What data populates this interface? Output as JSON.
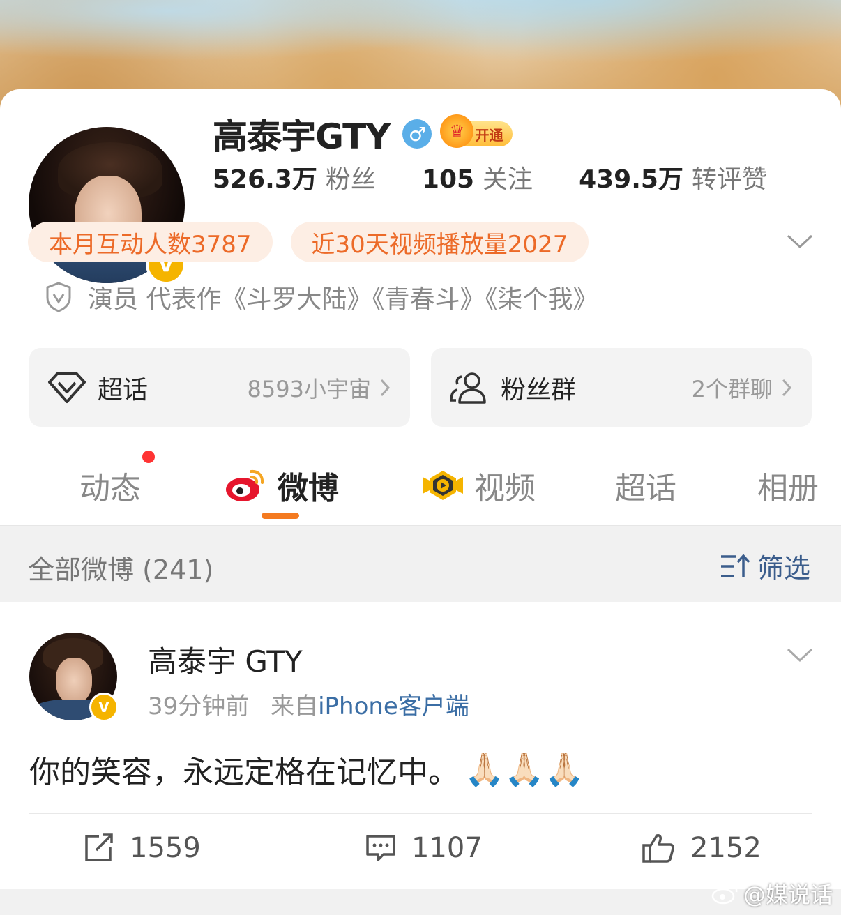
{
  "profile": {
    "name": "高泰宇GTY",
    "gender_icon": "male-icon",
    "gender_symbol": "♂",
    "vip_label": "开通",
    "verify_badge": "V",
    "stats": [
      {
        "num": "526.3万",
        "label": "粉丝"
      },
      {
        "num": "105",
        "label": "关注"
      },
      {
        "num": "439.5万",
        "label": "转评赞"
      }
    ],
    "pills": [
      "本月互动人数3787",
      "近30天视频播放量2027"
    ],
    "verification": "演员 代表作《斗罗大陆》《青春斗》《柒个我》"
  },
  "boxes": [
    {
      "title": "超话",
      "right": "8593小宇宙",
      "icon": "diamond-icon"
    },
    {
      "title": "粉丝群",
      "right": "2个群聊",
      "icon": "group-icon"
    }
  ],
  "tabs": [
    {
      "label": "动态"
    },
    {
      "label": "微博"
    },
    {
      "label": "视频"
    },
    {
      "label": "超话"
    },
    {
      "label": "相册"
    }
  ],
  "filterbar": {
    "all_label": "全部微博 (241)",
    "filter_label": "筛选"
  },
  "post": {
    "author": "高泰宇 GTY",
    "time": "39分钟前",
    "source_prefix": "来自",
    "source": "iPhone客户端",
    "text": "你的笑容，永远定格在记忆中。",
    "emoji": "🙏🏻🙏🏻🙏🏻",
    "reposts": "1559",
    "comments": "1107",
    "likes": "2152"
  },
  "watermark": "@媒说话",
  "colors": {
    "accent_orange": "#f47a20",
    "pill_text": "#ec6a28",
    "pill_bg": "#fdeee4",
    "link_blue": "#3b6ea5",
    "verify_gold": "#f5b400"
  }
}
